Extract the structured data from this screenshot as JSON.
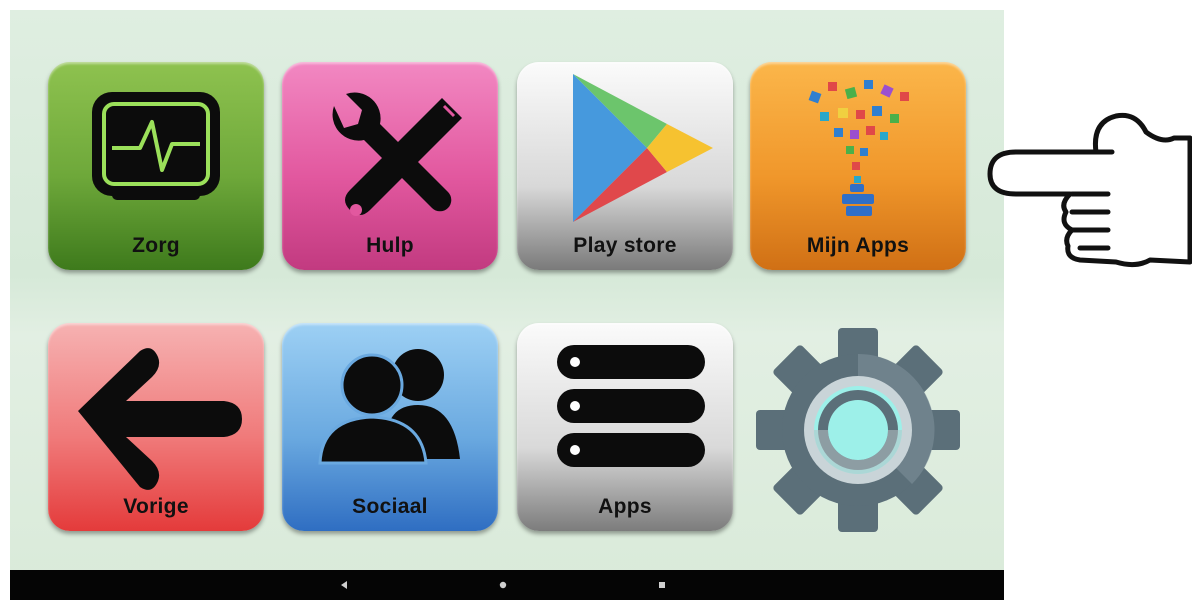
{
  "tiles": {
    "zorg": {
      "label": "Zorg",
      "icon": "monitor-heartbeat-icon"
    },
    "hulp": {
      "label": "Hulp",
      "icon": "wrench-screwdriver-icon"
    },
    "play": {
      "label": "Play store",
      "icon": "play-store-icon"
    },
    "mijn": {
      "label": "Mijn Apps",
      "icon": "app-funnel-icon"
    },
    "vorige": {
      "label": "Vorige",
      "icon": "arrow-left-icon"
    },
    "sociaal": {
      "label": "Sociaal",
      "icon": "people-icon"
    },
    "apps": {
      "label": "Apps",
      "icon": "list-icon"
    }
  },
  "settings": {
    "icon": "gear-icon"
  },
  "navbar": {
    "back": "back-icon",
    "home": "home-icon",
    "recent": "recent-apps-icon"
  },
  "pointer": {
    "icon": "pointing-hand-icon"
  },
  "colors": {
    "zorg": "#6ea83a",
    "hulp": "#e2589f",
    "mijn": "#f0972b",
    "vorige": "#f07a7a",
    "sociaal": "#6aa9e0",
    "gear": "#5b6f79",
    "gear_ring": "#9df0e9"
  }
}
